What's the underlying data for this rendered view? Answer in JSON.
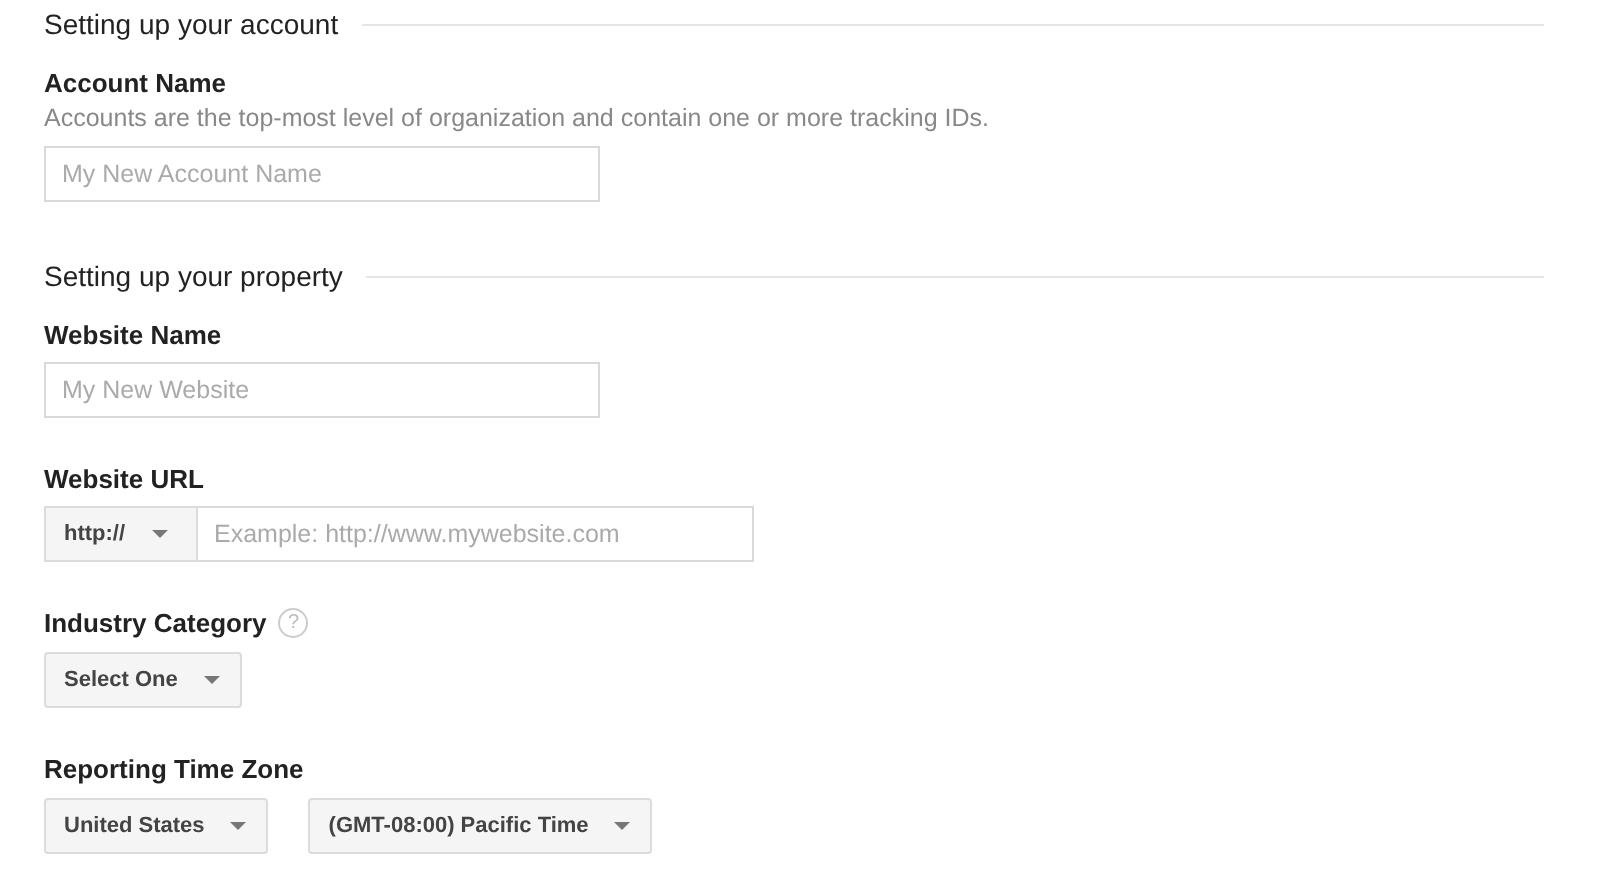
{
  "sections": [
    {
      "title": "Setting up your account",
      "fields": [
        {
          "kind": "text",
          "label": "Account Name",
          "description": "Accounts are the top-most level of organization and contain one or more tracking IDs.",
          "placeholder": "My New Account Name"
        }
      ]
    },
    {
      "title": "Setting up your property",
      "fields": [
        {
          "kind": "text",
          "label": "Website Name",
          "placeholder": "My New Website"
        },
        {
          "kind": "url",
          "label": "Website URL",
          "protocol": "http://",
          "placeholder": "Example: http://www.mywebsite.com"
        },
        {
          "kind": "select",
          "label": "Industry Category",
          "help": "?",
          "selects": [
            "Select One"
          ]
        },
        {
          "kind": "select",
          "label": "Reporting Time Zone",
          "selects": [
            "United States",
            "(GMT-08:00) Pacific Time"
          ]
        }
      ]
    }
  ]
}
